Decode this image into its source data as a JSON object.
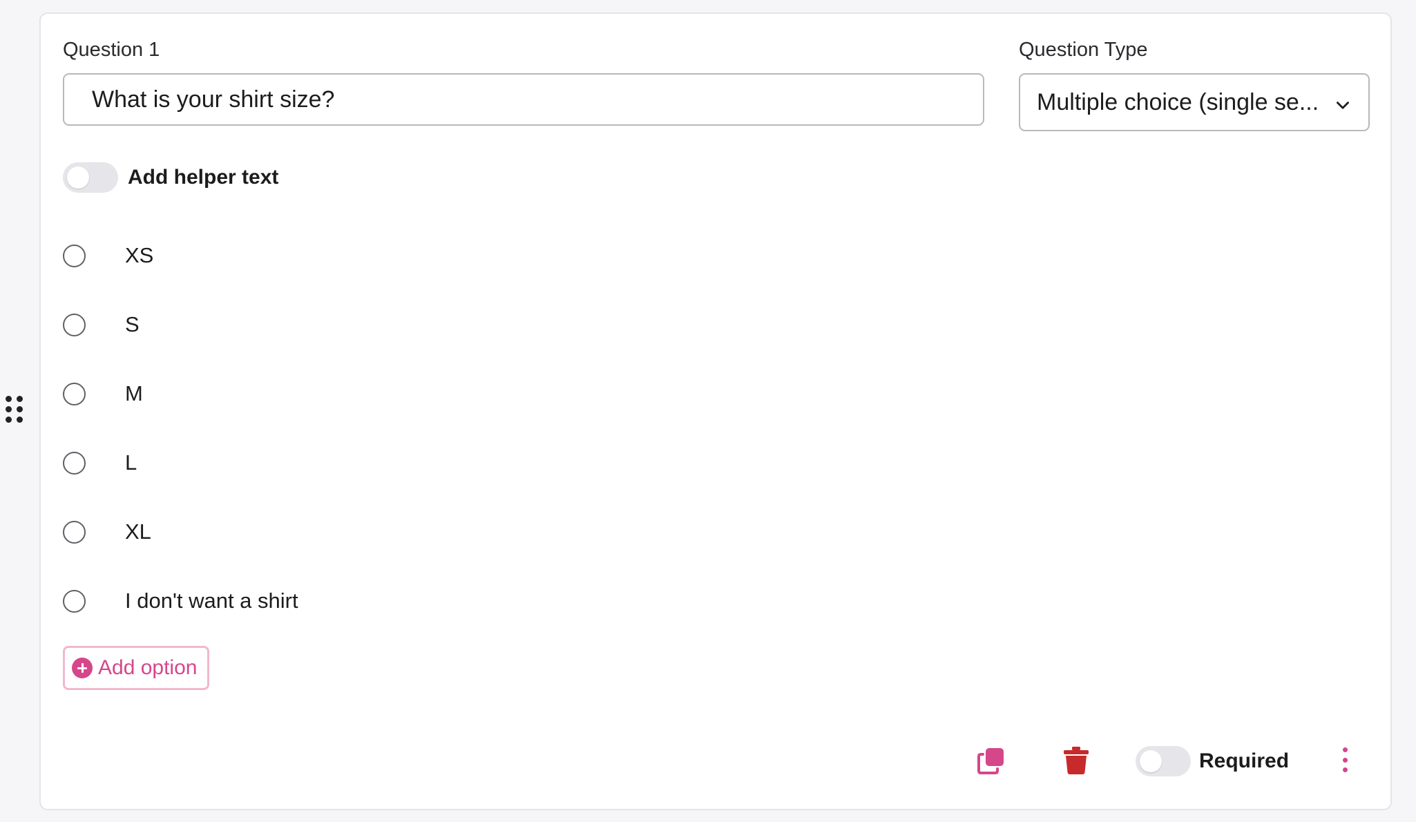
{
  "question": {
    "label": "Question 1",
    "value": "What is your shirt size?"
  },
  "question_type": {
    "label": "Question Type",
    "selected": "Multiple choice (single se..."
  },
  "helper_text": {
    "label": "Add helper text",
    "enabled": false
  },
  "options": [
    {
      "label": "XS"
    },
    {
      "label": "S"
    },
    {
      "label": "M"
    },
    {
      "label": "L"
    },
    {
      "label": "XL"
    },
    {
      "label": "I don't want a shirt"
    }
  ],
  "add_option": {
    "label": "Add option"
  },
  "footer": {
    "required_label": "Required",
    "required_enabled": false
  },
  "colors": {
    "accent": "#d6468b",
    "danger": "#c62a2a",
    "border": "#b8b8bd"
  },
  "icons": {
    "drag": "drag-handle-icon",
    "duplicate": "duplicate-icon",
    "delete": "trash-icon",
    "more": "more-vertical-icon",
    "add": "plus-circle-icon",
    "dropdown": "chevron-down-icon"
  }
}
